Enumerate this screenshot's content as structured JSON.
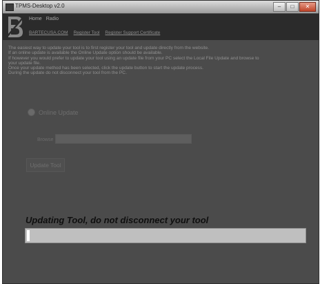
{
  "window": {
    "title": "TPMS-Desktop v2.0",
    "controls": [
      "–",
      "□",
      "✕"
    ]
  },
  "header": {
    "menu": [
      "Home",
      "Radio"
    ],
    "links": [
      "BARTECUSA.COM",
      "Register Tool",
      "Register Support Certificate"
    ]
  },
  "instructions": [
    "The easiest way to update your tool is to first register your tool and update directly from the website.",
    "If an online update is available the Online Update option should be available.",
    "If however you would prefer to update your tool using an update file from your PC select the Local File Update and browse to",
    "your update file.",
    "Once your update method has been selected, click the update button to start the update process.",
    "During the update do not disconnect your tool from the PC."
  ],
  "online_update": {
    "label": "Online Update",
    "selected": false
  },
  "browse": {
    "label": "Browse",
    "value": ""
  },
  "update_button": {
    "label": "Update Tool"
  },
  "status": {
    "message": "Updating Tool, do not disconnect your tool"
  },
  "progress": {
    "fraction": 0.01
  },
  "colors": {
    "window_bg": "#4b4b4b",
    "header_bg": "#2b2b2b",
    "progress_bg": "#bfbfbf"
  }
}
